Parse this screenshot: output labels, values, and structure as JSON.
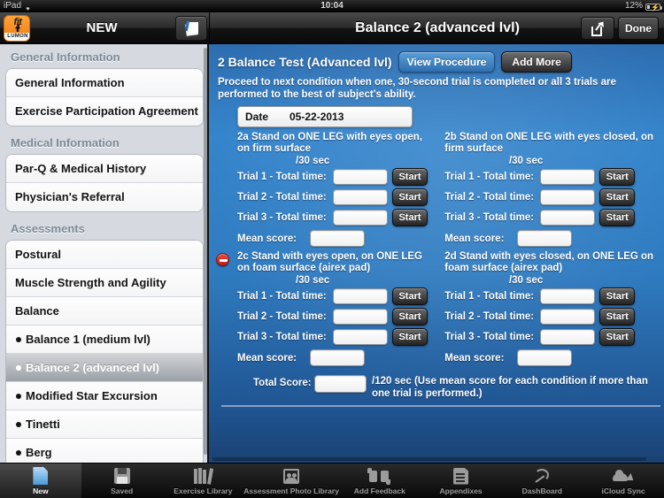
{
  "status_bar": {
    "device": "iPad",
    "wifi_icon": "wifi-icon",
    "time": "10:04",
    "battery_percent": "12%",
    "battery_icon": "battery-charging-icon"
  },
  "nav_bar": {
    "logo_text": "fit",
    "logo_subtext": "LUMON",
    "left_title": "NEW",
    "notes_icon": "notes-icon",
    "title": "Balance 2 (advanced lvl)",
    "share_icon": "share-icon",
    "done_label": "Done"
  },
  "sidebar": {
    "sections": [
      {
        "header": "General Information",
        "items": [
          {
            "label": "General Information",
            "sub": false,
            "selected": false
          },
          {
            "label": "Exercise Participation Agreement",
            "sub": false,
            "selected": false
          }
        ]
      },
      {
        "header": "Medical Information",
        "items": [
          {
            "label": "Par-Q & Medical History",
            "sub": false,
            "selected": false
          },
          {
            "label": "Physician's Referral",
            "sub": false,
            "selected": false
          }
        ]
      },
      {
        "header": "Assessments",
        "items": [
          {
            "label": "Postural",
            "sub": false,
            "selected": false
          },
          {
            "label": "Muscle Strength and Agility",
            "sub": false,
            "selected": false
          },
          {
            "label": "Balance",
            "sub": false,
            "selected": false
          },
          {
            "label": "Balance 1 (medium lvl)",
            "sub": true,
            "selected": false
          },
          {
            "label": "Balance 2 (advanced lvl)",
            "sub": true,
            "selected": true
          },
          {
            "label": "Modified Star Excursion",
            "sub": true,
            "selected": false
          },
          {
            "label": "Tinetti",
            "sub": true,
            "selected": false
          },
          {
            "label": "Berg",
            "sub": true,
            "selected": false
          }
        ]
      }
    ]
  },
  "main": {
    "test_title": "2 Balance Test (Advanced lvl)",
    "view_procedure_label": "View Procedure",
    "add_more_label": "Add More",
    "instructions": "Proceed to next condition when one, 30-second trial is completed or all 3 trials are performed to the best of subject's ability.",
    "date_label": "Date",
    "date_value": "05-22-2013",
    "sec_unit": "/30 sec",
    "mean_label": "Mean score:",
    "start_label": "Start",
    "trial_labels": [
      "Trial 1 - Total time:",
      "Trial 2 - Total time:",
      "Trial 3 - Total time:"
    ],
    "conditions": [
      {
        "id": "2a",
        "title": "2a Stand on ONE LEG with eyes open, on firm surface",
        "has_delete": false,
        "trials": [
          "",
          "",
          ""
        ],
        "mean": ""
      },
      {
        "id": "2b",
        "title": "2b Stand on ONE LEG with eyes closed, on firm surface",
        "has_delete": false,
        "trials": [
          "",
          "",
          ""
        ],
        "mean": ""
      },
      {
        "id": "2c",
        "title": "2c Stand with eyes open, on ONE LEG on foam surface (airex pad)",
        "has_delete": true,
        "trials": [
          "",
          "",
          ""
        ],
        "mean": ""
      },
      {
        "id": "2d",
        "title": "2d Stand with eyes closed, on ONE LEG on foam surface (airex pad)",
        "has_delete": false,
        "trials": [
          "",
          "",
          ""
        ],
        "mean": ""
      }
    ],
    "total_label": "Total Score:",
    "total_value": "",
    "total_note": "/120 sec (Use mean score for each condition if more than one trial is performed.)"
  },
  "tab_bar": {
    "tabs": [
      {
        "label": "New",
        "icon": "new-document-icon",
        "active": true
      },
      {
        "label": "Saved",
        "icon": "floppy-disk-icon",
        "active": false
      },
      {
        "label": "Exercise Library",
        "icon": "books-icon",
        "active": false
      },
      {
        "label": "Assessment Photo Library",
        "icon": "photo-library-icon",
        "active": false
      },
      {
        "label": "Add Feedback",
        "icon": "thumbs-up-down-icon",
        "active": false
      },
      {
        "label": "Appendixes",
        "icon": "appendix-document-icon",
        "active": false
      },
      {
        "label": "DashBoard",
        "icon": "gauge-icon",
        "active": false
      },
      {
        "label": "iCloud Sync",
        "icon": "cloud-sync-icon",
        "active": false
      }
    ]
  },
  "colors": {
    "accent_blue": "#3585cc",
    "panel_dark_blue": "#1b4273",
    "logo_orange": "#f07c10",
    "delete_red": "#c4251f"
  }
}
